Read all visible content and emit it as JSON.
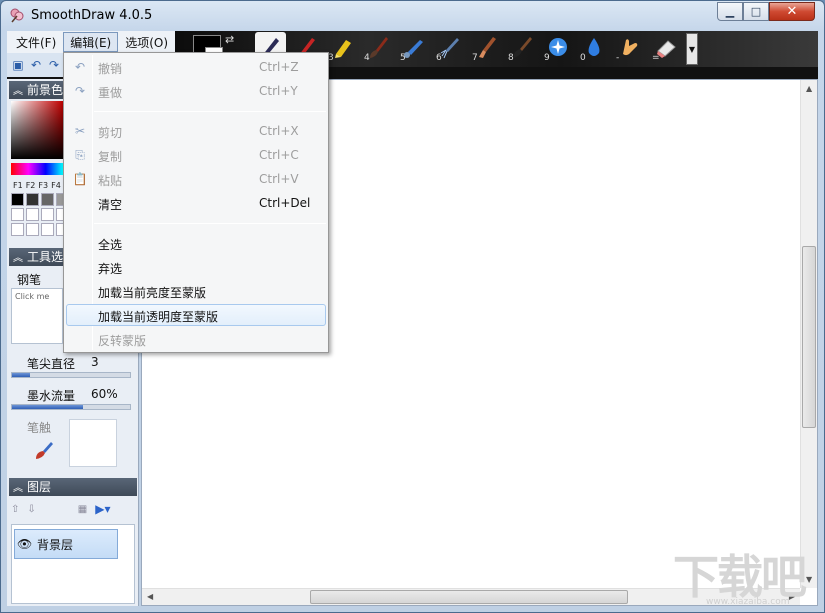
{
  "window": {
    "title": "SmoothDraw 4.0.5",
    "min_label": "▁",
    "max_label": "□",
    "close_label": "✕"
  },
  "menubar": {
    "file": "文件(F)",
    "edit": "编辑(E)",
    "options": "选项(O)"
  },
  "toolbar": {
    "tools": [
      {
        "name": "pen",
        "num": "1"
      },
      {
        "name": "pencil",
        "num": "2"
      },
      {
        "name": "marker",
        "num": "3"
      },
      {
        "name": "brush",
        "num": "4"
      },
      {
        "name": "airbrush",
        "num": "5"
      },
      {
        "name": "spray",
        "num": "6"
      },
      {
        "name": "flat-brush",
        "num": "7"
      },
      {
        "name": "ink-brush",
        "num": "8"
      },
      {
        "name": "sparkle",
        "num": "9"
      },
      {
        "name": "water-drop",
        "num": "0"
      },
      {
        "name": "smudge-hand",
        "num": "-"
      },
      {
        "name": "eraser",
        "num": "="
      }
    ]
  },
  "left_panel": {
    "color_section": "前景色",
    "fkeys": [
      "F1",
      "F2",
      "F3",
      "F4"
    ],
    "tools_section": "工具选",
    "tool_name": "钢笔",
    "click_me": "Click me",
    "tip_diameter_label": "笔尖直径",
    "tip_diameter_value": "3",
    "tip_diameter_fraction": 0.15,
    "ink_flow_label": "墨水流量",
    "ink_flow_value": "60%",
    "ink_flow_fraction": 0.6,
    "pen_tip_label": "笔触",
    "layers_section": "图层",
    "layer_name": "背景层"
  },
  "edit_menu": {
    "items": [
      {
        "label": "撤销",
        "shortcut": "Ctrl+Z",
        "disabled": true,
        "icon": "undo-icon"
      },
      {
        "label": "重做",
        "shortcut": "Ctrl+Y",
        "disabled": true,
        "icon": "redo-icon"
      },
      {
        "label": "剪切",
        "shortcut": "Ctrl+X",
        "disabled": true,
        "icon": "cut-icon"
      },
      {
        "label": "复制",
        "shortcut": "Ctrl+C",
        "disabled": true,
        "icon": "copy-icon"
      },
      {
        "label": "粘贴",
        "shortcut": "Ctrl+V",
        "disabled": true,
        "icon": "paste-icon"
      },
      {
        "label": "清空",
        "shortcut": "Ctrl+Del",
        "disabled": false,
        "icon": ""
      },
      {
        "label": "全选",
        "shortcut": "",
        "disabled": false,
        "icon": ""
      },
      {
        "label": "弃选",
        "shortcut": "",
        "disabled": false,
        "icon": ""
      },
      {
        "label": "加载当前亮度至蒙版",
        "shortcut": "",
        "disabled": false,
        "icon": ""
      },
      {
        "label": "加载当前透明度至蒙版",
        "shortcut": "",
        "disabled": false,
        "highlighted": true,
        "icon": ""
      },
      {
        "label": "反转蒙版",
        "shortcut": "",
        "disabled": true,
        "icon": ""
      }
    ]
  },
  "watermark": {
    "text": "下载吧",
    "url": "www.xiazaiba.com"
  },
  "colors": {
    "highlight_border": "#a8c9ee",
    "panel_header": "#4a5564",
    "slider_fill": "#2f5fb6"
  }
}
